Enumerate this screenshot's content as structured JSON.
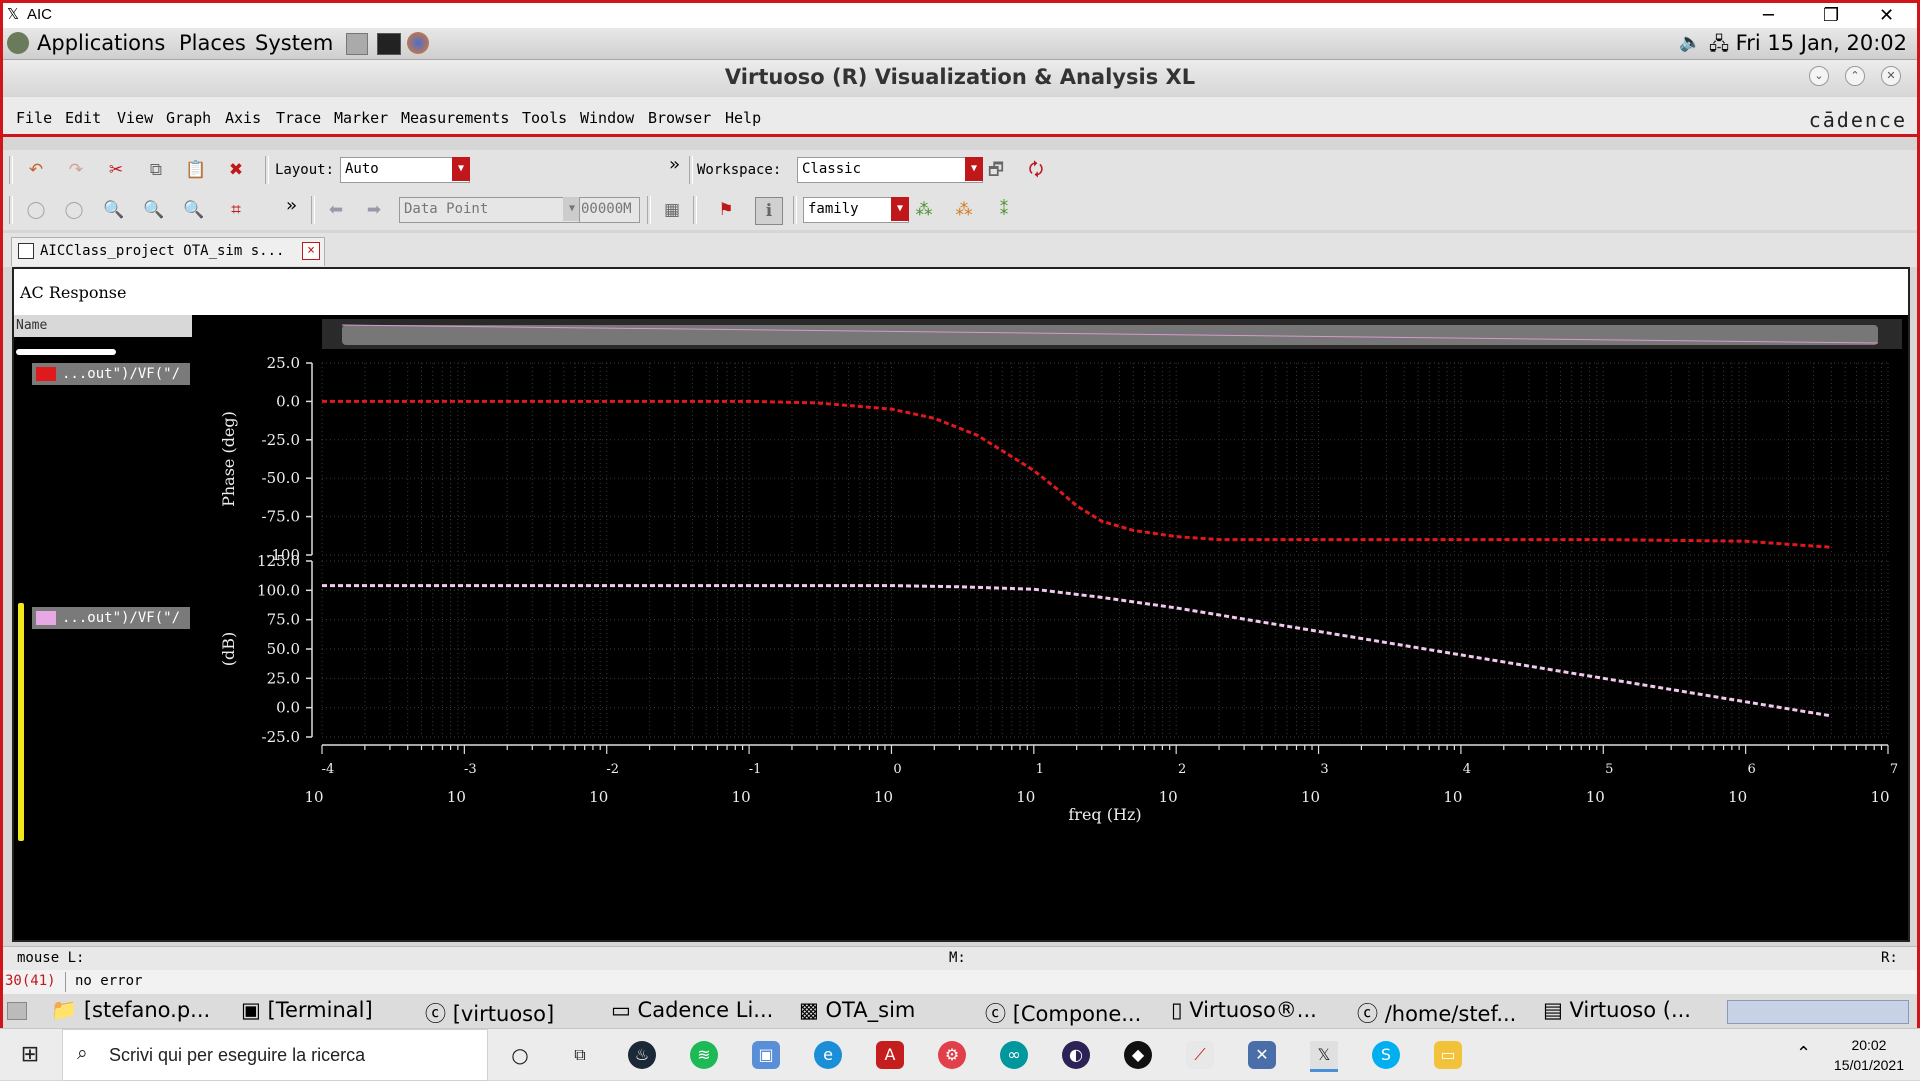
{
  "xwindow": {
    "title": "AIC"
  },
  "gnome_panel": {
    "menus": [
      "Applications",
      "Places",
      "System"
    ],
    "datetime": "Fri 15 Jan, 20:02"
  },
  "app": {
    "title": "Virtuoso (R) Visualization & Analysis XL",
    "brand": "cādence"
  },
  "menubar": [
    "File",
    "Edit",
    "View",
    "Graph",
    "Axis",
    "Trace",
    "Marker",
    "Measurements",
    "Tools",
    "Window",
    "Browser",
    "Help"
  ],
  "toolbar1": {
    "layout_label": "Layout:",
    "layout_value": "Auto",
    "workspace_label": "Workspace:",
    "workspace_value": "Classic",
    "overflow": "»"
  },
  "toolbar2": {
    "marker_mode": "Data Point",
    "marker_value": "00000M",
    "family": "family",
    "overflow": "»"
  },
  "tab": {
    "label": "AICClass_project OTA_sim s...",
    "close": "×"
  },
  "panel": {
    "title": "AC Response",
    "legend_header": "Name",
    "traces": [
      {
        "label": "...out\")/VF(\"/",
        "color": "#e0191d"
      },
      {
        "label": "...out\")/VF(\"/",
        "color": "#e8a8e4"
      }
    ]
  },
  "chart_data": [
    {
      "type": "line",
      "title": "",
      "xlabel": "freq (Hz)",
      "ylabel": "Phase (deg)",
      "xscale": "log",
      "xlim": [
        0.0001,
        10000000
      ],
      "ylim": [
        -100,
        25
      ],
      "yticks": [
        "25.0",
        "0.0",
        "-25.0",
        "-50.0",
        "-75.0",
        "-100"
      ],
      "grid": true,
      "series": [
        {
          "color": "#e0191d",
          "x": [
            0.0001,
            0.001,
            0.01,
            0.1,
            0.3,
            1,
            2,
            4,
            7,
            10,
            15,
            20,
            30,
            50,
            100,
            200,
            1000,
            10000,
            100000,
            1000000,
            4000000
          ],
          "y": [
            0,
            0,
            0,
            0,
            -1,
            -5,
            -11,
            -22,
            -36,
            -45,
            -58,
            -68,
            -78,
            -84,
            -88,
            -90,
            -90,
            -90,
            -90,
            -91,
            -95
          ]
        }
      ]
    },
    {
      "type": "line",
      "title": "",
      "xlabel": "freq (Hz)",
      "ylabel": "(dB)",
      "xscale": "log",
      "xlim": [
        0.0001,
        10000000
      ],
      "ylim": [
        -25,
        125
      ],
      "yticks": [
        "125.0",
        "100.0",
        "75.0",
        "50.0",
        "25.0",
        "0.0",
        "-25.0"
      ],
      "grid": true,
      "series": [
        {
          "color": "#f2c8ee",
          "x": [
            0.0001,
            0.001,
            0.01,
            0.1,
            1,
            3,
            10,
            30,
            100,
            1000,
            10000,
            100000,
            1000000,
            4000000
          ],
          "y": [
            104,
            104,
            104,
            104,
            104,
            103,
            101,
            94,
            85,
            65,
            45,
            25,
            5,
            -7
          ]
        }
      ]
    }
  ],
  "xaxis_ticks": {
    "base": "10",
    "exponents": [
      "-4",
      "-3",
      "-2",
      "-1",
      "0",
      "1",
      "2",
      "3",
      "4",
      "5",
      "6",
      "7"
    ]
  },
  "status": {
    "mouse_l": "mouse L:",
    "mouse_m": "M:",
    "mouse_r": "R:",
    "cmd_index": "30(41)",
    "message": "no error"
  },
  "gnome_taskbar": [
    "[stefano.p...",
    "[Terminal]",
    "[virtuoso]",
    "Cadence Li...",
    "OTA_sim",
    "[Compone...",
    "Virtuoso®...",
    "/home/stef...",
    "Virtuoso (..."
  ],
  "windows_taskbar": {
    "search_placeholder": "Scrivi qui per eseguire la ricerca",
    "time": "20:02",
    "date": "15/01/2021"
  }
}
